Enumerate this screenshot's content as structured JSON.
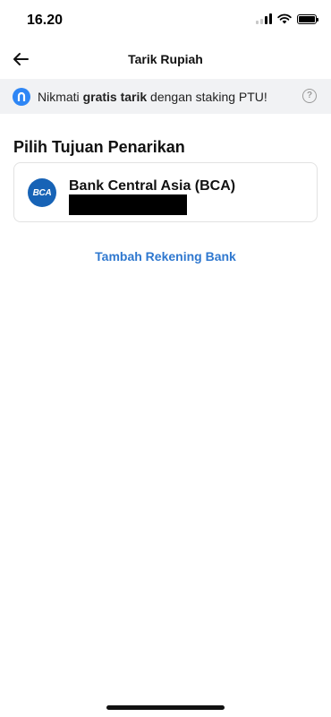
{
  "status_bar": {
    "time": "16.20",
    "icons": [
      "signal-icon",
      "wifi-icon",
      "battery-icon"
    ]
  },
  "header": {
    "title": "Tarik Rupiah",
    "back_icon": "arrow-left-icon"
  },
  "promo": {
    "text_before": "Nikmati ",
    "text_bold": "gratis tarik",
    "text_after": " dengan staking PTU!",
    "help_symbol": "?",
    "accent": "#2e86f5"
  },
  "section": {
    "title": "Pilih Tujuan Penarikan"
  },
  "bank": {
    "logo_text": "BCA",
    "name": "Bank Central Asia (BCA)",
    "logo_color": "#1763b6"
  },
  "actions": {
    "add_bank_label": "Tambah Rekening Bank",
    "link_color": "#2f78cf"
  }
}
